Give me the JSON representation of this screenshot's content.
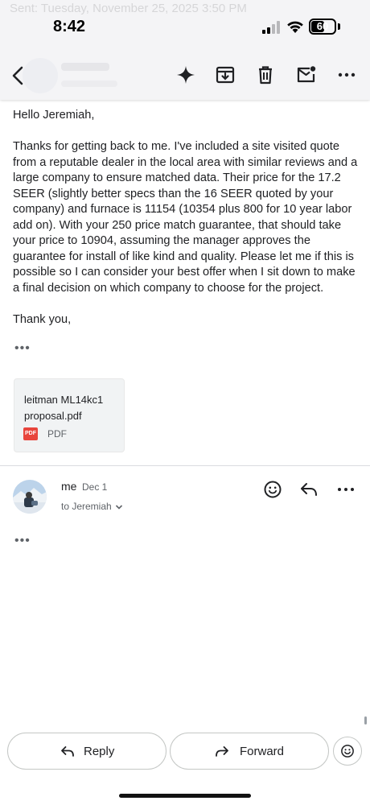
{
  "status_bar": {
    "time": "8:42",
    "battery": "60",
    "battery_level": 0.6
  },
  "ghost_header": "Sent: Tuesday, November 25, 2025 3:50 PM",
  "toolbar": {
    "back": "back-arrow-icon",
    "icons": [
      "sparkle-icon",
      "archive-icon",
      "trash-icon",
      "mark-unread-icon",
      "more-vert-icon"
    ]
  },
  "message": {
    "greeting": "Hello Jeremiah,",
    "body": "Thanks for getting back to me.  I've included a site visited quote from a reputable dealer in the local area with similar reviews and a large company to ensure matched data.  Their price for the 17.2 SEER (slightly better specs than the 16 SEER quoted by your company) and furnace is 11154 (10354 plus 800 for 10 year labor add on).  With your 250 price match guarantee, that should take your price to 10904, assuming the manager approves the guarantee for install of like kind and quality.  Please let me if this is possible so I can consider your best offer when I sit down to make a final decision on which company to choose for the project.",
    "signoff": "Thank you,",
    "ellipsis": "•••"
  },
  "attachment": {
    "name": "leitman ML14kc1 proposal.pdf",
    "badge": "PDF",
    "type": "PDF"
  },
  "reply_message": {
    "from": "me",
    "date": "Dec 1",
    "to": "to Jeremiah",
    "ellipsis": "•••"
  },
  "actions": {
    "reply": "Reply",
    "forward": "Forward"
  },
  "colors": {
    "pdf_red": "#e8453c",
    "text": "#202124",
    "secondary": "#5f6368"
  }
}
